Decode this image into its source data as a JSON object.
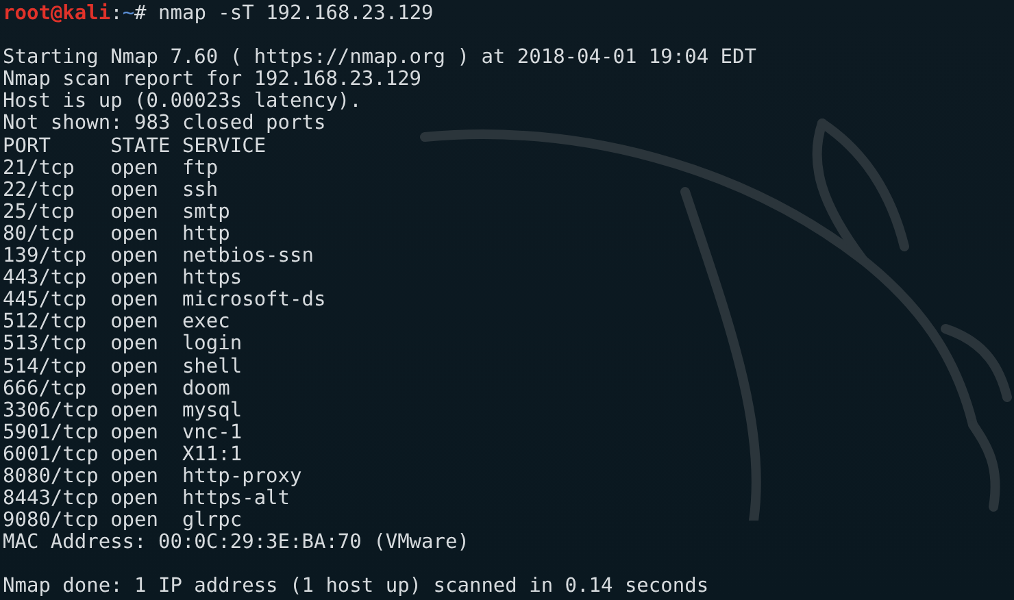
{
  "prompt": {
    "user_host": "root@kali",
    "separator": ":",
    "path": "~",
    "command": "# nmap -sT 192.168.23.129"
  },
  "output": [
    {
      "kind": "blank"
    },
    {
      "kind": "text",
      "text": "Starting Nmap 7.60 ( https://nmap.org ) at 2018-04-01 19:04 EDT"
    },
    {
      "kind": "text",
      "text": "Nmap scan report for 192.168.23.129"
    },
    {
      "kind": "text",
      "text": "Host is up (0.00023s latency)."
    },
    {
      "kind": "text",
      "text": "Not shown: 983 closed ports"
    },
    {
      "kind": "text",
      "text": "PORT     STATE SERVICE"
    },
    {
      "kind": "text",
      "text": "21/tcp   open  ftp"
    },
    {
      "kind": "text",
      "text": "22/tcp   open  ssh"
    },
    {
      "kind": "text",
      "text": "25/tcp   open  smtp"
    },
    {
      "kind": "text",
      "text": "80/tcp   open  http"
    },
    {
      "kind": "text",
      "text": "139/tcp  open  netbios-ssn"
    },
    {
      "kind": "text",
      "text": "443/tcp  open  https"
    },
    {
      "kind": "text",
      "text": "445/tcp  open  microsoft-ds"
    },
    {
      "kind": "text",
      "text": "512/tcp  open  exec"
    },
    {
      "kind": "text",
      "text": "513/tcp  open  login"
    },
    {
      "kind": "text",
      "text": "514/tcp  open  shell"
    },
    {
      "kind": "text",
      "text": "666/tcp  open  doom"
    },
    {
      "kind": "text",
      "text": "3306/tcp open  mysql"
    },
    {
      "kind": "text",
      "text": "5901/tcp open  vnc-1"
    },
    {
      "kind": "text",
      "text": "6001/tcp open  X11:1"
    },
    {
      "kind": "text",
      "text": "8080/tcp open  http-proxy"
    },
    {
      "kind": "text",
      "text": "8443/tcp open  https-alt"
    },
    {
      "kind": "text",
      "text": "9080/tcp open  glrpc"
    },
    {
      "kind": "text",
      "text": "MAC Address: 00:0C:29:3E:BA:70 (VMware)"
    },
    {
      "kind": "blank"
    },
    {
      "kind": "text",
      "text": "Nmap done: 1 IP address (1 host up) scanned in 0.14 seconds"
    }
  ]
}
